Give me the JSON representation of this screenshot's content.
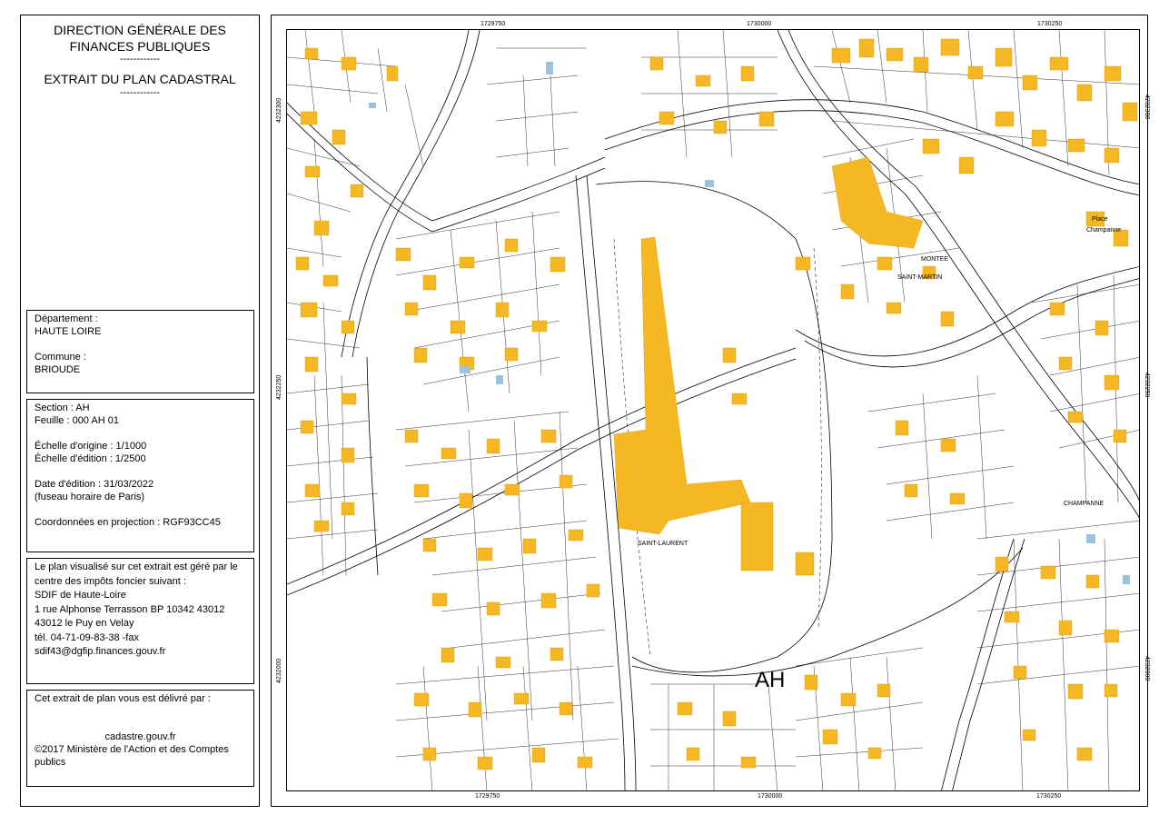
{
  "header": {
    "line1": "DIRECTION GÉNÉRALE DES",
    "line2": "FINANCES PUBLIQUES",
    "sep1": "------------",
    "line3": "EXTRAIT DU PLAN CADASTRAL",
    "sep2": "------------"
  },
  "location": {
    "departement_label": "Département :",
    "departement_value": "HAUTE LOIRE",
    "commune_label": "Commune :",
    "commune_value": "BRIOUDE"
  },
  "sheet": {
    "section": "Section : AH",
    "feuille": "Feuille : 000 AH 01",
    "echelle_origine": "Échelle d'origine : 1/1000",
    "echelle_edition": "Échelle d'édition : 1/2500",
    "date_edition": "Date d'édition : 31/03/2022",
    "fuseau": "(fuseau horaire de Paris)",
    "coordonnees": "Coordonnées en projection : RGF93CC45"
  },
  "management": {
    "line1": "Le plan visualisé sur cet extrait est géré par le",
    "line2": "centre des impôts foncier suivant :",
    "line3": "SDIF de Haute-Loire",
    "line4": "1 rue Alphonse Terrasson BP 10342 43012",
    "line5": "43012 le Puy en Velay",
    "line6": "tél. 04-71-09-83-38 -fax",
    "line7": "sdif43@dgfip.finances.gouv.fr"
  },
  "delivery": {
    "line1": "Cet extrait de plan vous est délivré par :",
    "line2": "cadastre.gouv.fr",
    "line3": "©2017 Ministère de l'Action et des Comptes",
    "line4": "publics"
  },
  "map": {
    "x_coords": [
      "1729750",
      "1730000",
      "1730250"
    ],
    "y_coords": [
      "4232300",
      "4232250",
      "4232000"
    ],
    "section_label": "AH",
    "place_names": [
      "MONTEE",
      "SAINT-MARTIN",
      "SAINT-LAURENT",
      "CHAMPANNE",
      "Place",
      "Champanne"
    ],
    "colors": {
      "building": "#f5b822",
      "line": "#000000",
      "blue": "#9cc3dd"
    }
  }
}
